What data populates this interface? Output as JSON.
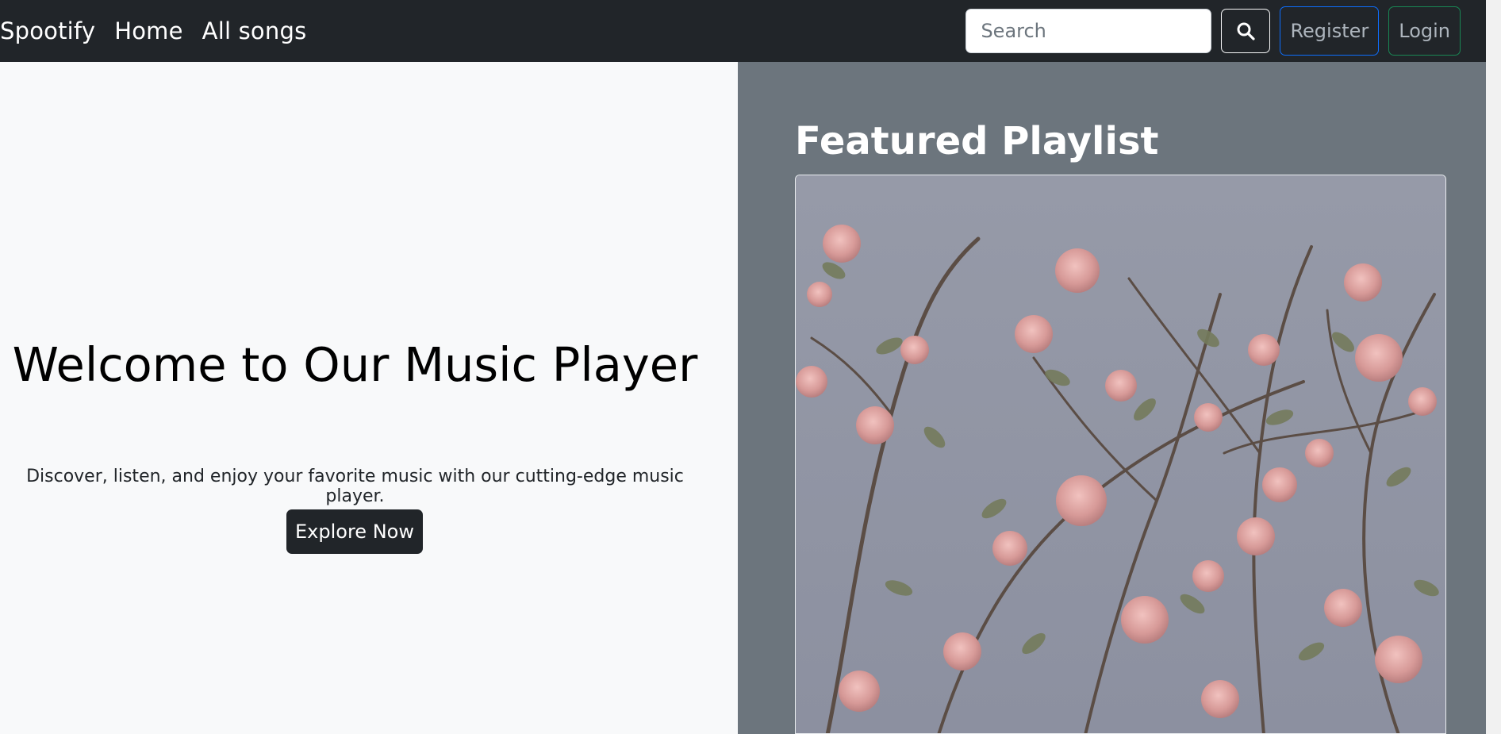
{
  "navbar": {
    "brand": "Spootify",
    "links": [
      {
        "label": "Home"
      },
      {
        "label": "All songs"
      }
    ],
    "search": {
      "placeholder": "Search",
      "value": "",
      "icon": "search-icon"
    },
    "register_label": "Register",
    "login_label": "Login"
  },
  "hero": {
    "title": "Welcome to Our Music Player",
    "text": "Discover, listen, and enjoy your favorite music with our cutting-edge music player.",
    "cta_label": "Explore Now"
  },
  "featured": {
    "title": "Featured Playlist",
    "image": "pink-blossom-branches-photo"
  },
  "colors": {
    "navbar_bg": "#212529",
    "hero_bg": "#f8f9fa",
    "featured_bg": "#6c757d",
    "register_border": "#0d6efd",
    "login_border": "#198754"
  }
}
